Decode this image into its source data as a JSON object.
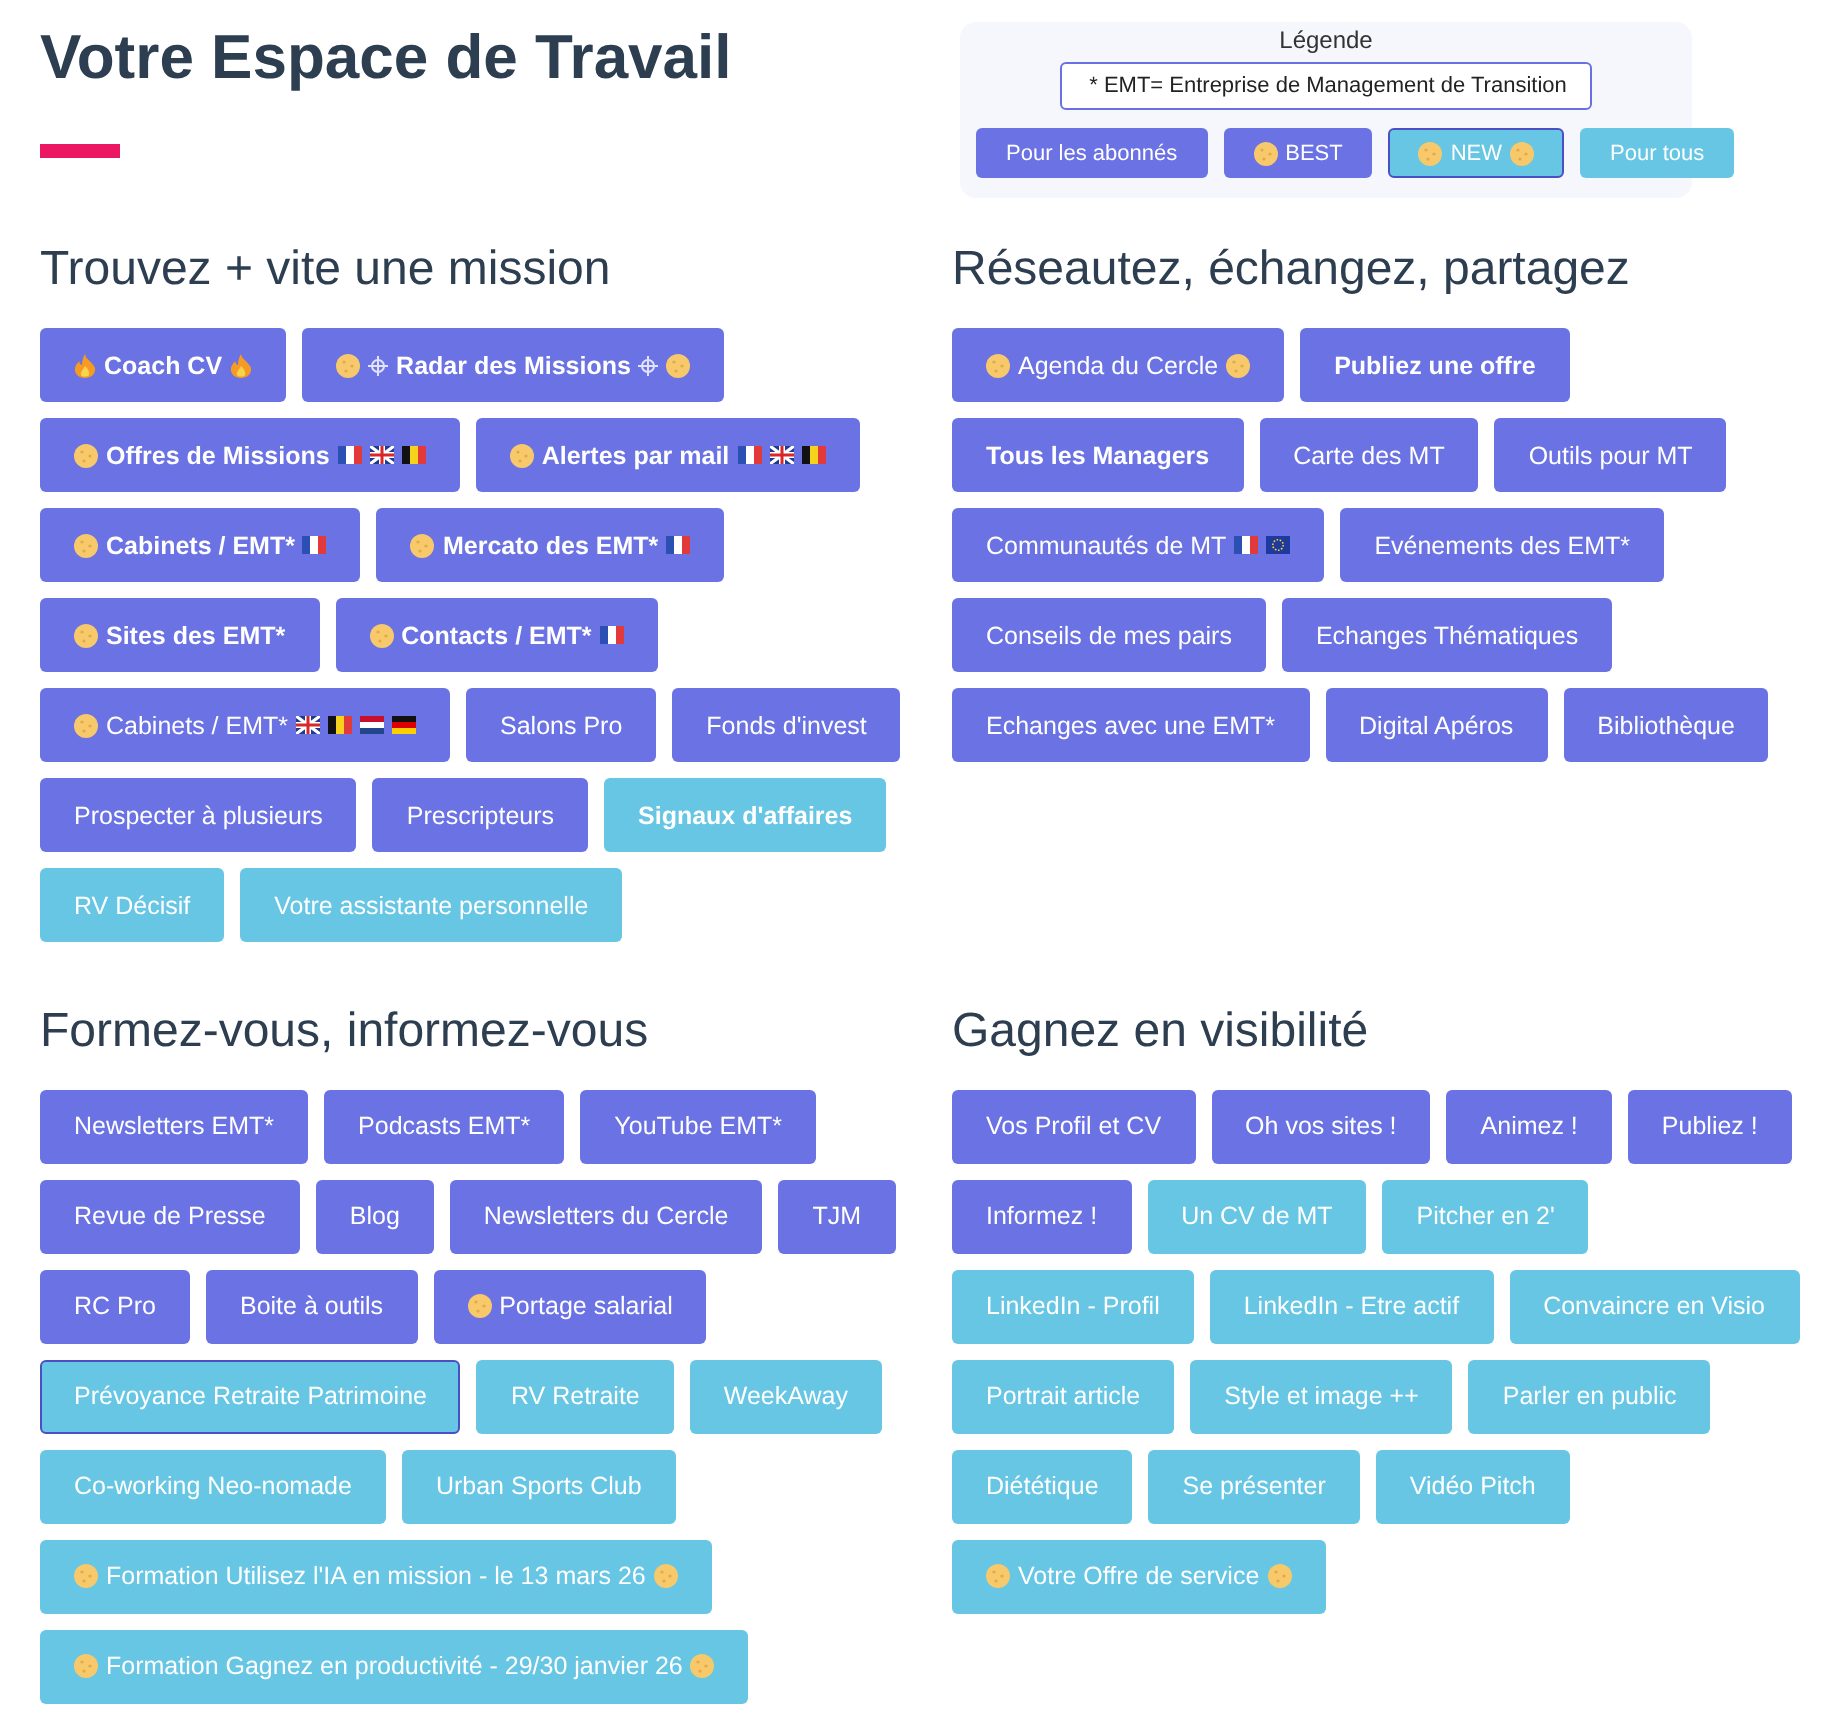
{
  "title": "Votre Espace de Travail",
  "legend": {
    "title": "Légende",
    "note": "* EMT= Entreprise de Management de Transition",
    "items": [
      {
        "label": "Pour les abonnés",
        "color": "#6b72e3"
      },
      {
        "label": "BEST",
        "color": "#6b72e3",
        "icons_before": [
          {
            "kind": "cookie"
          }
        ]
      },
      {
        "label": "NEW",
        "color": "#66c6e4",
        "outlined": true,
        "icons_before": [
          {
            "kind": "cookie"
          }
        ],
        "icons_after": [
          {
            "kind": "cookie"
          }
        ]
      },
      {
        "label": "Pour tous",
        "color": "#66c6e4"
      }
    ]
  },
  "sections": [
    {
      "heading": "Trouvez + vite une mission",
      "rows": [
        [
          {
            "label": "Coach CV",
            "color": "#6b72e3",
            "bold": true,
            "icons_before": [
              {
                "kind": "fire"
              }
            ],
            "icons_after": [
              {
                "kind": "fire"
              }
            ]
          },
          {
            "label": "Radar des Missions",
            "color": "#6b72e3",
            "bold": true,
            "icons_before": [
              {
                "kind": "cookie"
              },
              {
                "kind": "crosshair"
              }
            ],
            "icons_after": [
              {
                "kind": "crosshair"
              },
              {
                "kind": "cookie"
              }
            ]
          }
        ],
        [
          {
            "label": "Offres de Missions",
            "color": "#6b72e3",
            "bold": true,
            "icons_before": [
              {
                "kind": "cookie"
              }
            ],
            "icons_after": [
              {
                "kind": "flag-fr"
              },
              {
                "kind": "flag-gb"
              },
              {
                "kind": "flag-be"
              }
            ]
          },
          {
            "label": "Alertes par mail",
            "color": "#6b72e3",
            "bold": true,
            "icons_before": [
              {
                "kind": "cookie"
              }
            ],
            "icons_after": [
              {
                "kind": "flag-fr"
              },
              {
                "kind": "flag-gb"
              },
              {
                "kind": "flag-be"
              }
            ]
          }
        ],
        [
          {
            "label": "Cabinets / EMT*",
            "color": "#6b72e3",
            "bold": true,
            "icons_before": [
              {
                "kind": "cookie"
              }
            ],
            "icons_after": [
              {
                "kind": "flag-fr"
              }
            ]
          },
          {
            "label": "Mercato des EMT*",
            "color": "#6b72e3",
            "bold": true,
            "icons_before": [
              {
                "kind": "cookie"
              }
            ],
            "icons_after": [
              {
                "kind": "flag-fr"
              }
            ]
          }
        ],
        [
          {
            "label": "Sites des EMT*",
            "color": "#6b72e3",
            "bold": true,
            "icons_before": [
              {
                "kind": "cookie"
              }
            ]
          },
          {
            "label": "Contacts / EMT*",
            "color": "#6b72e3",
            "bold": true,
            "icons_before": [
              {
                "kind": "cookie"
              }
            ],
            "icons_after": [
              {
                "kind": "flag-fr"
              }
            ]
          }
        ],
        [
          {
            "label": "Cabinets / EMT*",
            "color": "#6b72e3",
            "icons_before": [
              {
                "kind": "cookie"
              }
            ],
            "icons_after": [
              {
                "kind": "flag-gb"
              },
              {
                "kind": "flag-be"
              },
              {
                "kind": "flag-nl"
              },
              {
                "kind": "flag-de"
              }
            ]
          },
          {
            "label": "Salons Pro",
            "color": "#6b72e3"
          },
          {
            "label": "Fonds d'invest",
            "color": "#6b72e3"
          }
        ],
        [
          {
            "label": "Prospecter à plusieurs",
            "color": "#6b72e3"
          },
          {
            "label": "Prescripteurs",
            "color": "#6b72e3"
          },
          {
            "label": "Signaux d'affaires",
            "color": "#66c6e4",
            "bold": true
          }
        ],
        [
          {
            "label": "RV Décisif",
            "color": "#66c6e4"
          },
          {
            "label": "Votre assistante personnelle",
            "color": "#66c6e4"
          }
        ]
      ]
    },
    {
      "heading": "Réseautez, échangez, partagez",
      "rows": [
        [
          {
            "label": "Agenda du Cercle",
            "color": "#6b72e3",
            "icons_before": [
              {
                "kind": "cookie"
              }
            ],
            "icons_after": [
              {
                "kind": "cookie"
              }
            ]
          },
          {
            "label": "Publiez une offre",
            "color": "#6b72e3",
            "bold": true
          }
        ],
        [
          {
            "label": "Tous les Managers",
            "color": "#6b72e3",
            "bold": true
          },
          {
            "label": "Carte des MT",
            "color": "#6b72e3"
          },
          {
            "label": "Outils pour MT",
            "color": "#6b72e3"
          }
        ],
        [
          {
            "label": "Communautés de MT",
            "color": "#6b72e3",
            "icons_after": [
              {
                "kind": "flag-fr"
              },
              {
                "kind": "flag-eu"
              }
            ]
          },
          {
            "label": "Evénements des EMT*",
            "color": "#6b72e3"
          }
        ],
        [
          {
            "label": "Conseils de mes pairs",
            "color": "#6b72e3"
          },
          {
            "label": "Echanges Thématiques",
            "color": "#6b72e3"
          }
        ],
        [
          {
            "label": "Echanges avec une EMT*",
            "color": "#6b72e3"
          },
          {
            "label": "Digital Apéros",
            "color": "#6b72e3"
          },
          {
            "label": "Bibliothèque",
            "color": "#6b72e3"
          }
        ]
      ]
    },
    {
      "heading": "Formez-vous, informez-vous",
      "rows": [
        [
          {
            "label": "Newsletters EMT*",
            "color": "#6b72e3"
          },
          {
            "label": "Podcasts EMT*",
            "color": "#6b72e3"
          },
          {
            "label": "YouTube EMT*",
            "color": "#6b72e3"
          }
        ],
        [
          {
            "label": "Revue de Presse",
            "color": "#6b72e3"
          },
          {
            "label": "Blog",
            "color": "#6b72e3"
          },
          {
            "label": "Newsletters du Cercle",
            "color": "#6b72e3"
          },
          {
            "label": "TJM",
            "color": "#6b72e3"
          }
        ],
        [
          {
            "label": "RC Pro",
            "color": "#6b72e3"
          },
          {
            "label": "Boite à outils",
            "color": "#6b72e3"
          },
          {
            "label": "Portage salarial",
            "color": "#6b72e3",
            "icons_before": [
              {
                "kind": "cookie"
              }
            ]
          }
        ],
        [
          {
            "label": "Prévoyance Retraite Patrimoine",
            "color": "#66c6e4",
            "outlined": true
          },
          {
            "label": "RV Retraite",
            "color": "#66c6e4"
          },
          {
            "label": "WeekAway",
            "color": "#66c6e4"
          }
        ],
        [
          {
            "label": "Co-working Neo-nomade",
            "color": "#66c6e4"
          },
          {
            "label": "Urban Sports Club",
            "color": "#66c6e4"
          }
        ],
        [
          {
            "label": "Formation Utilisez l'IA en mission - le 13 mars 26",
            "color": "#66c6e4",
            "icons_before": [
              {
                "kind": "cookie"
              }
            ],
            "icons_after": [
              {
                "kind": "cookie"
              }
            ]
          }
        ],
        [
          {
            "label": "Formation Gagnez en productivité - 29/30 janvier 26",
            "color": "#66c6e4",
            "icons_before": [
              {
                "kind": "cookie"
              }
            ],
            "icons_after": [
              {
                "kind": "cookie"
              }
            ]
          }
        ]
      ]
    },
    {
      "heading": "Gagnez en visibilité",
      "rows": [
        [
          {
            "label": "Vos Profil et CV",
            "color": "#6b72e3"
          },
          {
            "label": "Oh vos sites !",
            "color": "#6b72e3"
          },
          {
            "label": "Animez !",
            "color": "#6b72e3"
          },
          {
            "label": "Publiez !",
            "color": "#6b72e3"
          }
        ],
        [
          {
            "label": "Informez !",
            "color": "#6b72e3"
          },
          {
            "label": "Un CV de MT",
            "color": "#66c6e4"
          },
          {
            "label": "Pitcher en 2'",
            "color": "#66c6e4"
          }
        ],
        [
          {
            "label": "LinkedIn - Profil",
            "color": "#66c6e4"
          },
          {
            "label": "LinkedIn - Etre actif",
            "color": "#66c6e4"
          },
          {
            "label": "Convaincre en Visio",
            "color": "#66c6e4"
          }
        ],
        [
          {
            "label": "Portrait article",
            "color": "#66c6e4"
          },
          {
            "label": "Style et image ++",
            "color": "#66c6e4"
          },
          {
            "label": "Parler en public",
            "color": "#66c6e4"
          }
        ],
        [
          {
            "label": "Diététique",
            "color": "#66c6e4"
          },
          {
            "label": "Se présenter",
            "color": "#66c6e4"
          },
          {
            "label": "Vidéo Pitch",
            "color": "#66c6e4"
          }
        ],
        [
          {
            "label": "Votre Offre de service",
            "color": "#66c6e4",
            "icons_before": [
              {
                "kind": "cookie"
              }
            ],
            "icons_after": [
              {
                "kind": "cookie"
              }
            ]
          }
        ]
      ]
    }
  ]
}
